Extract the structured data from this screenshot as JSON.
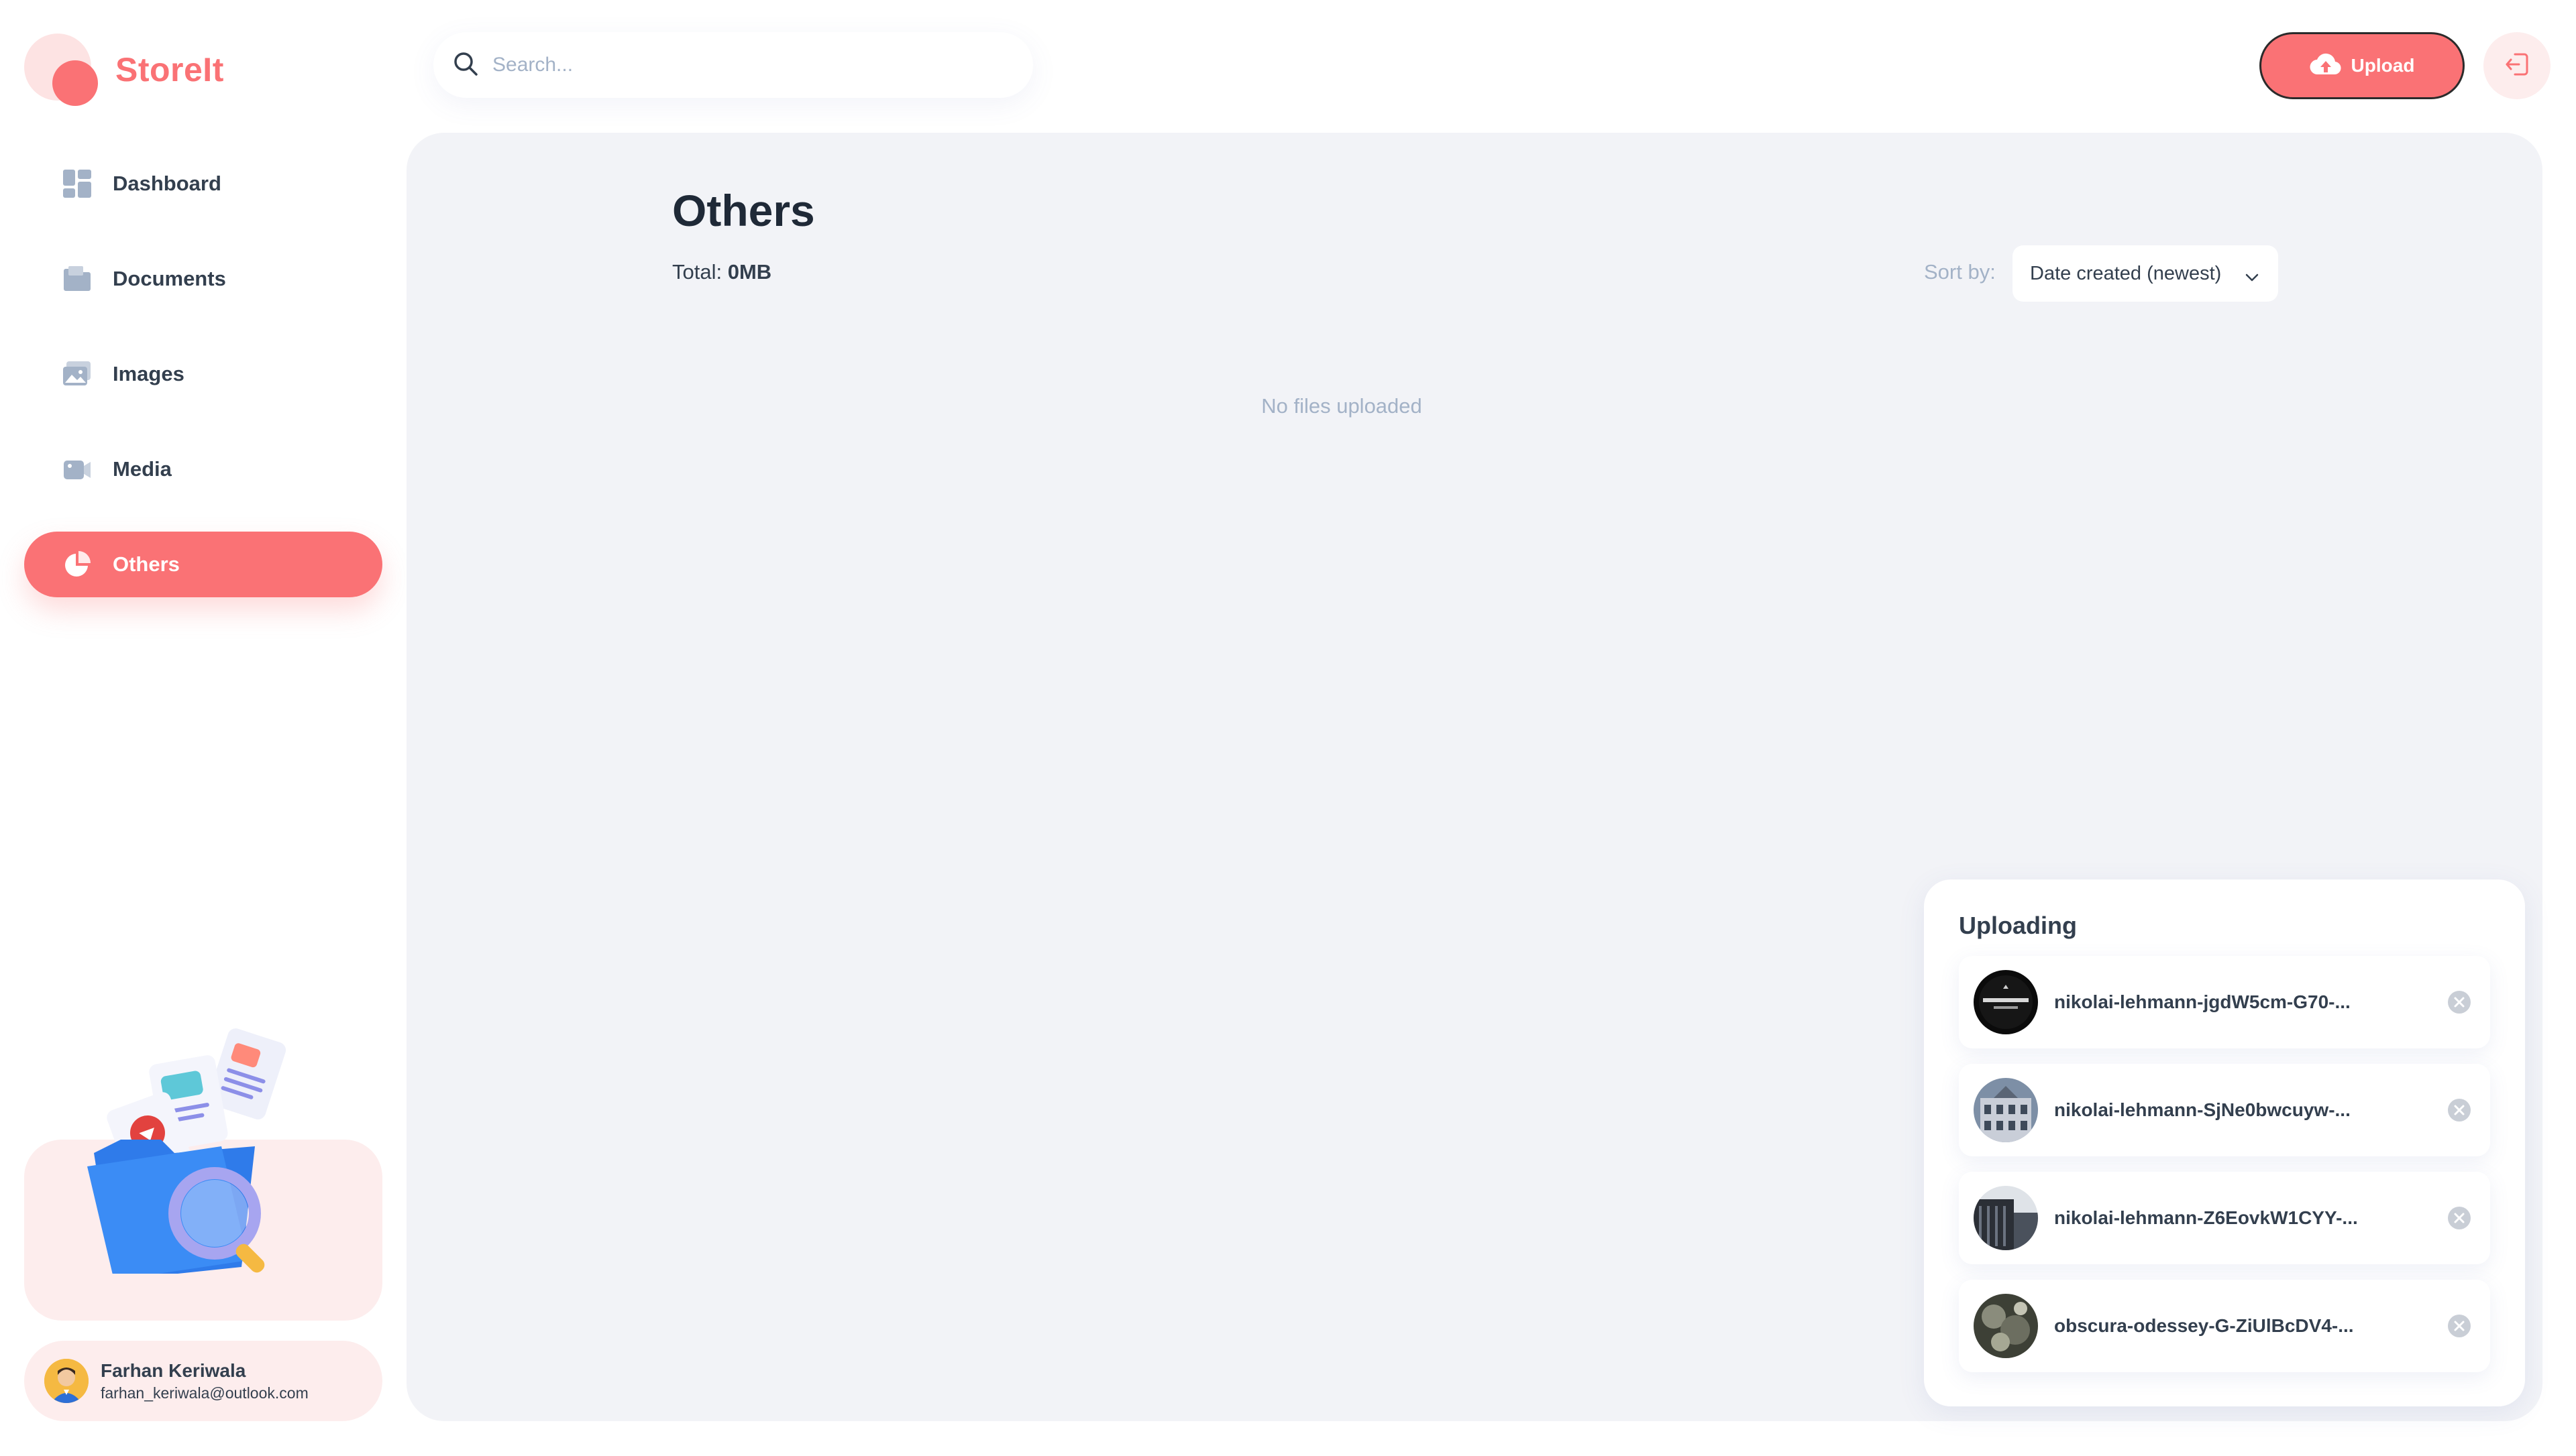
{
  "app": {
    "name": "StoreIt"
  },
  "colors": {
    "brand": "#FA7275",
    "brand_light": "#FDEDED",
    "text": "#333F4E",
    "muted": "#A3B2C7",
    "main_bg": "#F2F3F7"
  },
  "sidebar": {
    "items": [
      {
        "label": "Dashboard",
        "icon": "dashboard-icon",
        "active": false
      },
      {
        "label": "Documents",
        "icon": "documents-icon",
        "active": false
      },
      {
        "label": "Images",
        "icon": "images-icon",
        "active": false
      },
      {
        "label": "Media",
        "icon": "media-icon",
        "active": false
      },
      {
        "label": "Others",
        "icon": "others-icon",
        "active": true
      }
    ]
  },
  "user": {
    "name": "Farhan Keriwala",
    "email": "farhan_keriwala@outlook.com"
  },
  "header": {
    "search_placeholder": "Search...",
    "upload_label": "Upload"
  },
  "page": {
    "title": "Others",
    "total_label": "Total:",
    "total_value": "0MB",
    "sort_label": "Sort by:",
    "sort_value": "Date created (newest)",
    "empty_message": "No files uploaded"
  },
  "uploading": {
    "title": "Uploading",
    "files": [
      {
        "name": "nikolai-lehmann-jgdW5cm-G70-..."
      },
      {
        "name": "nikolai-lehmann-SjNe0bwcuyw-..."
      },
      {
        "name": "nikolai-lehmann-Z6EovkW1CYY-..."
      },
      {
        "name": "obscura-odessey-G-ZiUlBcDV4-..."
      }
    ]
  }
}
